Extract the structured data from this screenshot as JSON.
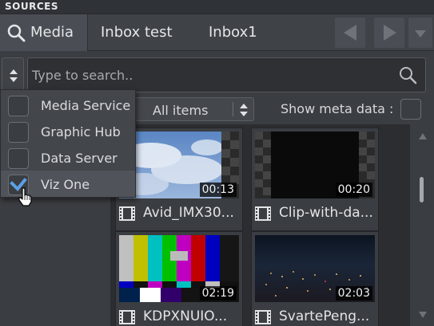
{
  "panel": {
    "title": "SOURCES"
  },
  "tabs": [
    {
      "label": "Media",
      "icon": "search-icon",
      "active": true
    },
    {
      "label": "Inbox test"
    },
    {
      "label": "Inbox1"
    }
  ],
  "search": {
    "placeholder": "Type to search.."
  },
  "filter": {
    "selected": "All items",
    "meta_label": "Show meta data :",
    "meta_checked": false
  },
  "sources_menu": [
    {
      "label": "Media Service",
      "checked": false
    },
    {
      "label": "Graphic Hub",
      "checked": false
    },
    {
      "label": "Data Server",
      "checked": false
    },
    {
      "label": "Viz One",
      "checked": true
    }
  ],
  "media_items": [
    {
      "name": "Avid_IMX30...",
      "duration": "00:13",
      "thumb": "clouds"
    },
    {
      "name": "Clip-with-da...",
      "duration": "00:20",
      "thumb": "black"
    },
    {
      "name": "KDPXNUIO...",
      "duration": "02:19",
      "thumb": "color-bars"
    },
    {
      "name": "SvartePeng...",
      "duration": "02:03",
      "thumb": "night-city"
    }
  ],
  "colors": {
    "background": "#3a3d41",
    "accent": "#5aa0e6"
  }
}
